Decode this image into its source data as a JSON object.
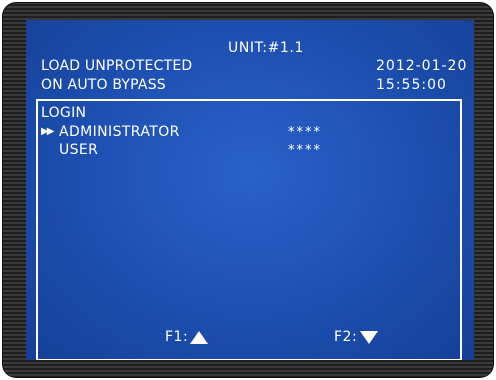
{
  "header": {
    "unit": "UNIT:#1.1",
    "status_line_1": "LOAD UNPROTECTED",
    "status_line_2": "ON AUTO BYPASS",
    "date": "2012-01-20",
    "time": "15:55:00"
  },
  "menu": {
    "title": "LOGIN",
    "cursor": "▶▶",
    "items": [
      {
        "label": "ADMINISTRATOR",
        "value": "****",
        "selected": true
      },
      {
        "label": "USER",
        "value": "****",
        "selected": false
      }
    ]
  },
  "function_keys": {
    "f1_label": "F1:",
    "f1_icon": "triangle-up-icon",
    "f2_label": "F2:",
    "f2_icon": "triangle-down-icon"
  },
  "colors": {
    "screen_blue": "#1d4fb0",
    "text": "#ffffff",
    "bezel": "#2e2e2e"
  }
}
